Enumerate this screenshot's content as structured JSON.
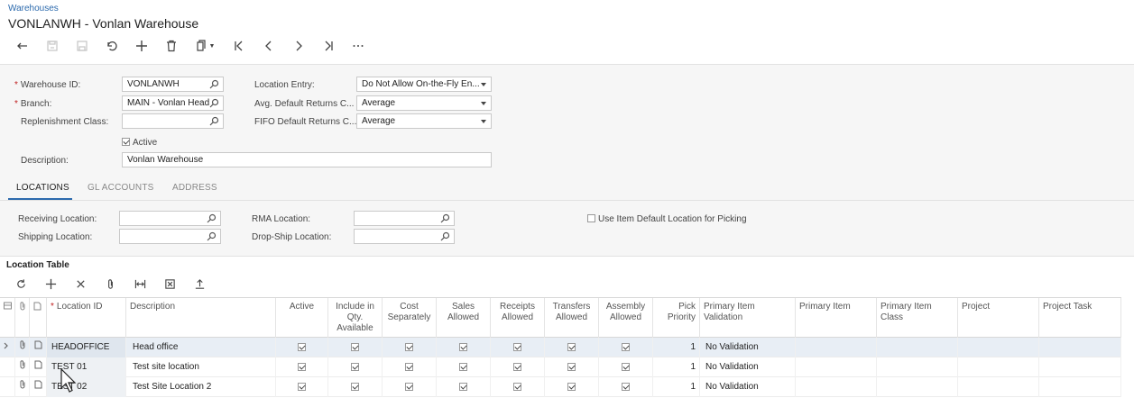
{
  "breadcrumb": "Warehouses",
  "title": "VONLANWH - Vonlan Warehouse",
  "form": {
    "warehouse_id_label": "Warehouse ID:",
    "warehouse_id_value": "VONLANWH",
    "branch_label": "Branch:",
    "branch_value": "MAIN - Vonlan Head",
    "replenishment_class_label": "Replenishment Class:",
    "replenishment_class_value": "",
    "active_label": "Active",
    "active_checked": true,
    "description_label": "Description:",
    "description_value": "Vonlan Warehouse",
    "location_entry_label": "Location Entry:",
    "location_entry_value": "Do Not Allow On-the-Fly En...",
    "avg_default_label": "Avg. Default Returns C...",
    "avg_default_value": "Average",
    "fifo_default_label": "FIFO Default Returns C...",
    "fifo_default_value": "Average"
  },
  "tabs": [
    "LOCATIONS",
    "GL ACCOUNTS",
    "ADDRESS"
  ],
  "locations": {
    "receiving_label": "Receiving Location:",
    "shipping_label": "Shipping Location:",
    "rma_label": "RMA Location:",
    "dropship_label": "Drop-Ship Location:",
    "use_item_default_label": "Use Item Default Location for Picking"
  },
  "table": {
    "title": "Location Table",
    "headers": {
      "location_id": "Location ID",
      "description": "Description",
      "active": "Active",
      "include_qty": "Include in Qty. Available",
      "cost_separately": "Cost Separately",
      "sales_allowed": "Sales Allowed",
      "receipts_allowed": "Receipts Allowed",
      "transfers_allowed": "Transfers Allowed",
      "assembly_allowed": "Assembly Allowed",
      "pick_priority": "Pick Priority",
      "primary_item_validation": "Primary Item Validation",
      "primary_item": "Primary Item",
      "primary_item_class": "Primary Item Class",
      "project": "Project",
      "project_task": "Project Task"
    },
    "rows": [
      {
        "location_id": "HEADOFFICE",
        "description": "Head office",
        "pick_priority": "1",
        "validation": "No Validation"
      },
      {
        "location_id": "TEST 01",
        "description": "Test site location",
        "pick_priority": "1",
        "validation": "No Validation"
      },
      {
        "location_id": "TEST 02",
        "description": "Test Site Location 2",
        "pick_priority": "1",
        "validation": "No Validation"
      }
    ]
  }
}
